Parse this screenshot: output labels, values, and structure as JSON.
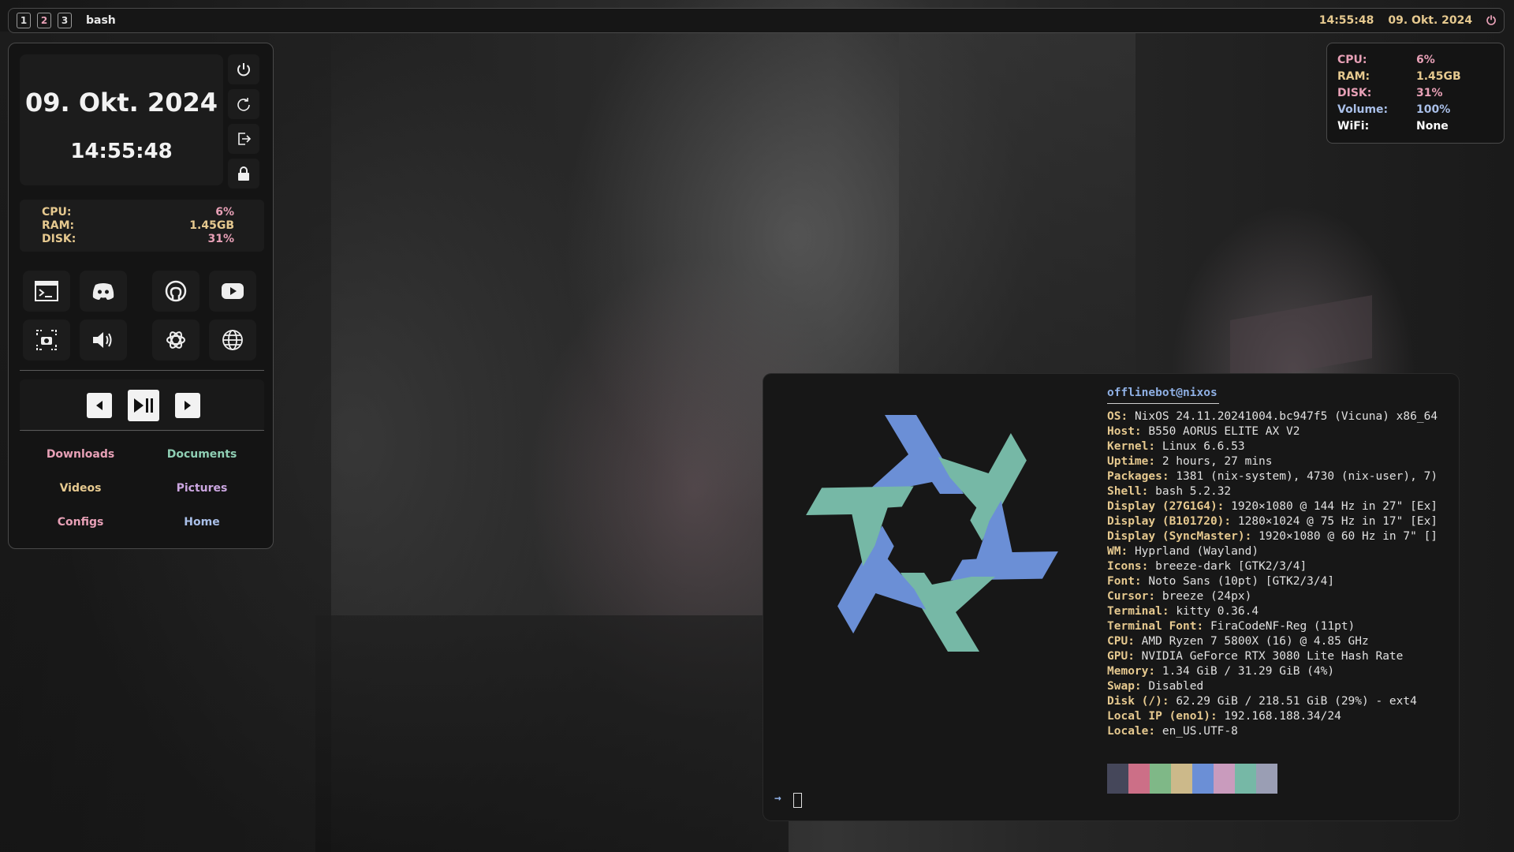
{
  "topbar": {
    "workspaces": [
      "1",
      "2",
      "3"
    ],
    "active_workspace": "2",
    "window_title": "bash",
    "time": "14:55:48",
    "date": "09. Okt. 2024",
    "power_icon": "power-icon"
  },
  "dashboard": {
    "date": "09. Okt. 2024",
    "time": "14:55:48",
    "power_buttons": [
      "power-icon",
      "restart-icon",
      "logout-icon",
      "lock-icon"
    ],
    "stats": [
      {
        "label": "CPU:",
        "value": "6%"
      },
      {
        "label": "RAM:",
        "value": "1.45GB"
      },
      {
        "label": "DISK:",
        "value": "31%"
      }
    ],
    "apps": [
      "terminal-icon",
      "discord-icon",
      "github-icon",
      "youtube-icon",
      "screenshot-icon",
      "volume-icon",
      "openai-icon",
      "browser-icon"
    ],
    "media": [
      "previous-icon",
      "play-pause-icon",
      "next-icon"
    ],
    "folders": [
      {
        "label": "Downloads",
        "color": "#e7a0b6"
      },
      {
        "label": "Documents",
        "color": "#8fcfb4"
      },
      {
        "label": "Videos",
        "color": "#e6c98f"
      },
      {
        "label": "Pictures",
        "color": "#cba6e0"
      },
      {
        "label": "Configs",
        "color": "#e7a0b6"
      },
      {
        "label": "Home",
        "color": "#a9bfe8"
      }
    ]
  },
  "system_info": [
    {
      "label": "CPU:",
      "value": "6%",
      "color": "#e7a0b6"
    },
    {
      "label": "RAM:",
      "value": "1.45GB",
      "color": "#e6c98f"
    },
    {
      "label": "DISK:",
      "value": "31%",
      "color": "#e7a0b6"
    },
    {
      "label": "Volume:",
      "value": "100%",
      "color": "#a9bfe8"
    },
    {
      "label": "WiFi:",
      "value": "None",
      "color": "#ffffff"
    }
  ],
  "terminal": {
    "user_host": "offlinebot@nixos",
    "fetch": [
      {
        "key": "OS:",
        "value": "NixOS 24.11.20241004.bc947f5 (Vicuna) x86_64"
      },
      {
        "key": "Host:",
        "value": "B550 AORUS ELITE AX V2"
      },
      {
        "key": "Kernel:",
        "value": "Linux 6.6.53"
      },
      {
        "key": "Uptime:",
        "value": "2 hours, 27 mins"
      },
      {
        "key": "Packages:",
        "value": "1381 (nix-system), 4730 (nix-user), 7)"
      },
      {
        "key": "Shell:",
        "value": "bash 5.2.32"
      },
      {
        "key": "Display (27G1G4):",
        "value": "1920×1080 @ 144 Hz in 27\" [Ex]"
      },
      {
        "key": "Display (B101720):",
        "value": "1280×1024 @ 75 Hz in 17\" [Ex]"
      },
      {
        "key": "Display (SyncMaster):",
        "value": "1920×1080 @ 60 Hz in 7\" []"
      },
      {
        "key": "WM:",
        "value": "Hyprland (Wayland)"
      },
      {
        "key": "Icons:",
        "value": "breeze-dark [GTK2/3/4]"
      },
      {
        "key": "Font:",
        "value": "Noto Sans (10pt) [GTK2/3/4]"
      },
      {
        "key": "Cursor:",
        "value": "breeze (24px)"
      },
      {
        "key": "Terminal:",
        "value": "kitty 0.36.4"
      },
      {
        "key": "Terminal Font:",
        "value": "FiraCodeNF-Reg (11pt)"
      },
      {
        "key": "CPU:",
        "value": "AMD Ryzen 7 5800X (16) @ 4.85 GHz"
      },
      {
        "key": "GPU:",
        "value": "NVIDIA GeForce RTX 3080 Lite Hash Rate"
      },
      {
        "key": "Memory:",
        "value": "1.34 GiB / 31.29 GiB (4%)"
      },
      {
        "key": "Swap:",
        "value": "Disabled"
      },
      {
        "key": "Disk (/):",
        "value": "62.29 GiB / 218.51 GiB (29%) - ext4"
      },
      {
        "key": "Local IP (eno1):",
        "value": "192.168.188.34/24"
      },
      {
        "key": "Locale:",
        "value": "en_US.UTF-8"
      }
    ],
    "palette": [
      "#45475a",
      "#cc6f87",
      "#7fb887",
      "#ccb98a",
      "#6b8fd6",
      "#c99bbd",
      "#76b8a6",
      "#9a9eb4"
    ],
    "prompt": "→",
    "logo_colors": {
      "blue": "#6b8fd6",
      "teal": "#76b8a6"
    }
  }
}
